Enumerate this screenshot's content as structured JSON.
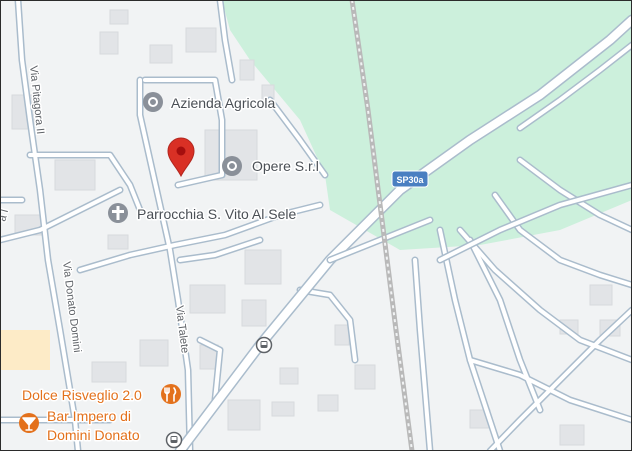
{
  "colors": {
    "land": "#f1f3f4",
    "park": "#ccf0dc",
    "road_fill": "#ffffff",
    "road_edge": "#aabccc",
    "building": "#e2e4e7",
    "railway": "#b0b0b0",
    "pin": "#d93025",
    "poi_gray": "#8a9099",
    "food": "#e3711c",
    "highway_shield": "#4a7fc1"
  },
  "places": {
    "azienda": {
      "label": "Azienda Agricola",
      "icon": "place-icon"
    },
    "opere": {
      "label": "Opere S.r.l",
      "icon": "place-icon"
    },
    "parrocchia": {
      "label": "Parrocchia S. Vito Al Sele",
      "icon": "church-cross-icon"
    },
    "dolce": {
      "label": "Dolce Risveglio 2.0",
      "icon": "restaurant-icon"
    },
    "bar_line1": "Bar Impero di",
    "bar_line2": "Domini Donato",
    "bar_icon": "cocktail-icon"
  },
  "streets": {
    "pitagora": "Via Pitagora II",
    "donato": "Via Donato Domini",
    "talete": "Via Talete",
    "edge_label": "a I"
  },
  "shield": {
    "label": "SP30a",
    "icon": "highway-shield"
  },
  "markers": {
    "pin": "location-pin-icon",
    "bus_stop": "bus-stop-icon"
  }
}
